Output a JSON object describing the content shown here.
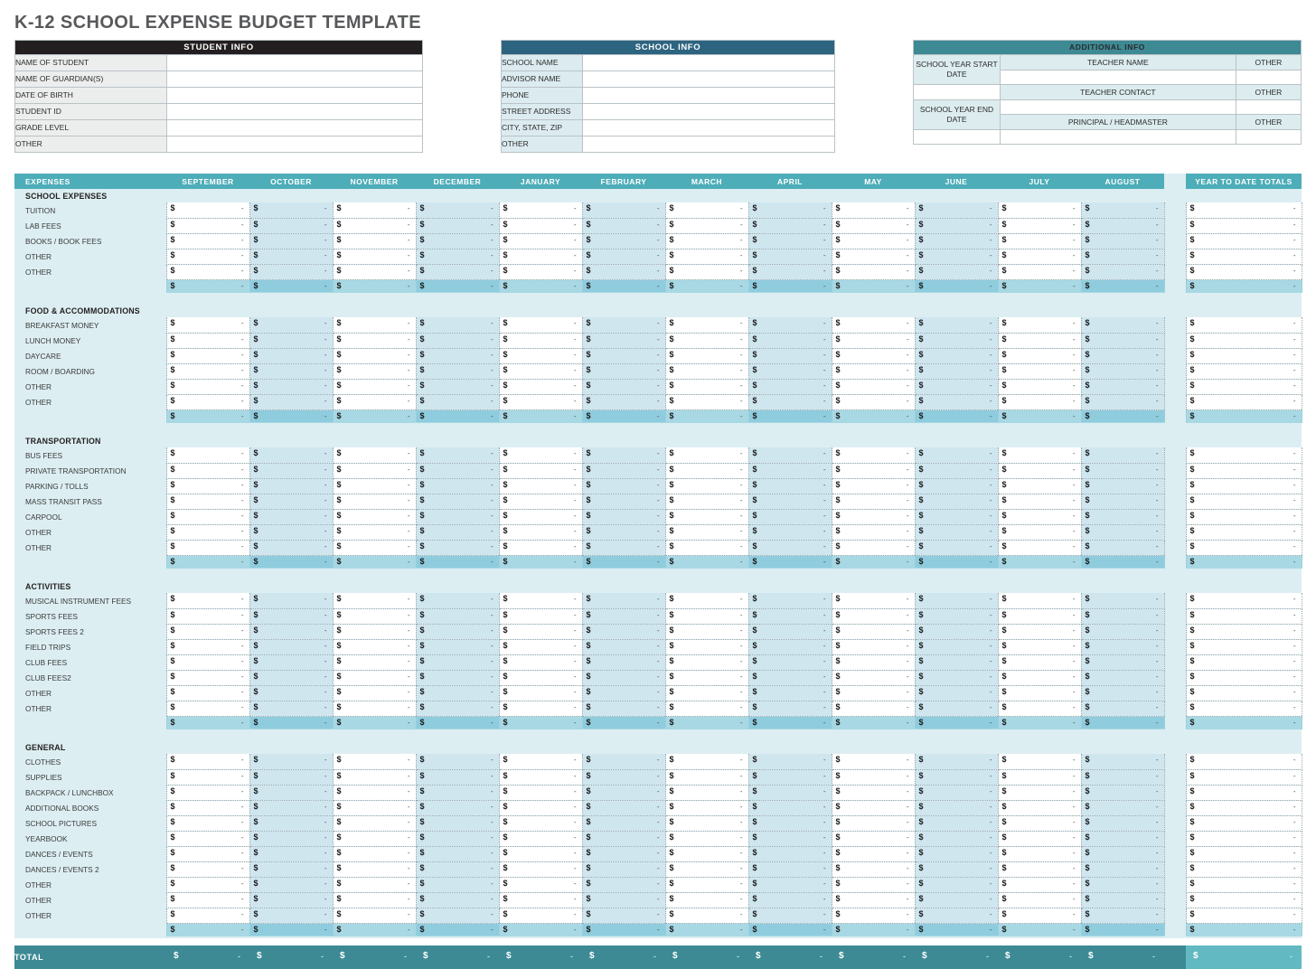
{
  "title": "K-12 SCHOOL EXPENSE BUDGET TEMPLATE",
  "colors": {
    "student_header_bg": "#231f20",
    "school_header_bg": "#2d6480",
    "additional_header_bg": "#3d8a94",
    "table_header_bg": "#4dadb8",
    "table_bg": "#dceef2",
    "alt_column_bg": "#cfe6ef",
    "subtotal_bg": "#a8d8e4",
    "total_bg": "#3d8a94",
    "total_ytd_bg": "#62b9c2"
  },
  "student_info": {
    "header": "STUDENT INFO",
    "fields": [
      {
        "label": "NAME OF STUDENT",
        "value": ""
      },
      {
        "label": "NAME OF GUARDIAN(S)",
        "value": ""
      },
      {
        "label": "DATE OF BIRTH",
        "value": ""
      },
      {
        "label": "STUDENT ID",
        "value": ""
      },
      {
        "label": "GRADE LEVEL",
        "value": ""
      },
      {
        "label": "OTHER",
        "value": ""
      }
    ]
  },
  "school_info": {
    "header": "SCHOOL INFO",
    "fields": [
      {
        "label": "SCHOOL NAME",
        "value": ""
      },
      {
        "label": "ADVISOR NAME",
        "value": ""
      },
      {
        "label": "PHONE",
        "value": ""
      },
      {
        "label": "STREET ADDRESS",
        "value": ""
      },
      {
        "label": "CITY, STATE, ZIP",
        "value": ""
      },
      {
        "label": "OTHER",
        "value": ""
      }
    ]
  },
  "additional_info": {
    "header": "ADDITIONAL INFO",
    "side_labels": {
      "start_date": "SCHOOL YEAR START DATE",
      "end_date": "SCHOOL YEAR END DATE"
    },
    "sub_headers": [
      {
        "main": "TEACHER NAME",
        "other": "OTHER"
      },
      {
        "main": "TEACHER CONTACT",
        "other": "OTHER"
      },
      {
        "main": "PRINCIPAL / HEADMASTER",
        "other": "OTHER"
      }
    ]
  },
  "budget_table": {
    "columns": [
      "EXPENSES",
      "SEPTEMBER",
      "OCTOBER",
      "NOVEMBER",
      "DECEMBER",
      "JANUARY",
      "FEBRUARY",
      "MARCH",
      "APRIL",
      "MAY",
      "JUNE",
      "JULY",
      "AUGUST",
      "YEAR TO DATE TOTALS"
    ],
    "currency_symbol": "$",
    "empty_value": "-",
    "sections": [
      {
        "name": "SCHOOL EXPENSES",
        "rows": [
          "TUITION",
          "LAB FEES",
          "BOOKS / BOOK FEES",
          "OTHER",
          "OTHER"
        ]
      },
      {
        "name": "FOOD & ACCOMMODATIONS",
        "rows": [
          "BREAKFAST MONEY",
          "LUNCH MONEY",
          "DAYCARE",
          "ROOM / BOARDING",
          "OTHER",
          "OTHER"
        ]
      },
      {
        "name": "TRANSPORTATION",
        "rows": [
          "BUS FEES",
          "PRIVATE TRANSPORTATION",
          "PARKING / TOLLS",
          "MASS TRANSIT PASS",
          "CARPOOL",
          "OTHER",
          "OTHER"
        ]
      },
      {
        "name": "ACTIVITIES",
        "rows": [
          "MUSICAL INSTRUMENT FEES",
          "SPORTS FEES",
          "SPORTS FEES 2",
          "FIELD TRIPS",
          "CLUB FEES",
          "CLUB FEES2",
          "OTHER",
          "OTHER"
        ]
      },
      {
        "name": "GENERAL",
        "rows": [
          "CLOTHES",
          "SUPPLIES",
          "BACKPACK / LUNCHBOX",
          "ADDITIONAL BOOKS",
          "SCHOOL PICTURES",
          "YEARBOOK",
          "DANCES / EVENTS",
          "DANCES / EVENTS 2",
          "OTHER",
          "OTHER",
          "OTHER"
        ]
      }
    ],
    "total_label": "TOTAL"
  }
}
